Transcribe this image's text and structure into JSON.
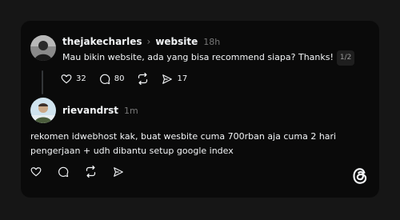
{
  "post": {
    "username": "thejakecharles",
    "topic": "website",
    "time": "18h",
    "text": "Mau bikin website, ada yang bisa recommend siapa? Thanks!",
    "pager": "1/2",
    "likes": "32",
    "comments": "80",
    "shares": "17"
  },
  "reply": {
    "username": "rievandrst",
    "time": "1m",
    "text_line1": "rekomen idwebhost kak, buat wesbite cuma 700rban aja cuma 2 hari",
    "text_line2": "pengerjaan + udh dibantu setup google index"
  },
  "icons": {
    "like": "heart-icon",
    "comment": "comment-icon",
    "repost": "repost-icon",
    "share": "send-icon",
    "brand": "threads-logo"
  },
  "colors": {
    "background": "#161616",
    "card": "#0a0a0a",
    "text": "#f3f5f7",
    "muted": "#777777"
  }
}
